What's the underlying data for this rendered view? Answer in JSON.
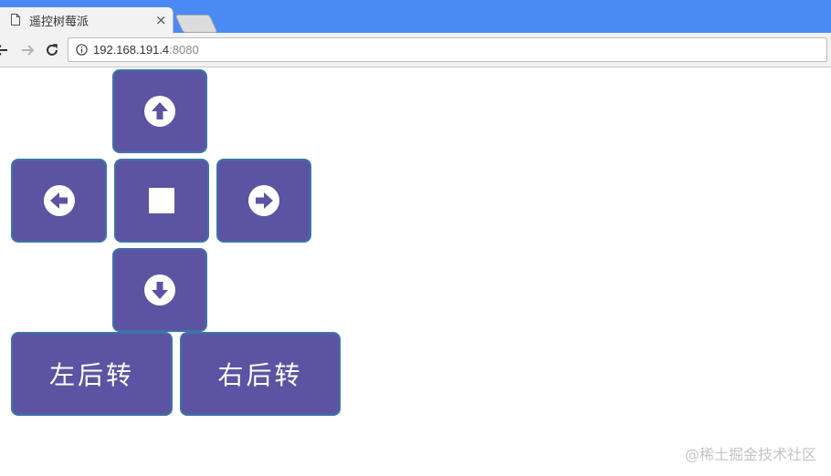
{
  "browser": {
    "tab": {
      "title": "遥控树莓派",
      "close_glyph": "×"
    },
    "address": {
      "host": "192.168.191.4",
      "port": ":8080"
    },
    "accent": "#4a8af4"
  },
  "controls": {
    "color": "#5c54a2",
    "border": "#3d73a8",
    "up_icon": "arrow-up-circle-icon",
    "left_icon": "arrow-left-circle-icon",
    "stop_icon": "stop-square-icon",
    "right_icon": "arrow-right-circle-icon",
    "down_icon": "arrow-down-circle-icon",
    "left_back_label": "左后转",
    "right_back_label": "右后转"
  },
  "watermark": "@稀土掘金技术社区"
}
